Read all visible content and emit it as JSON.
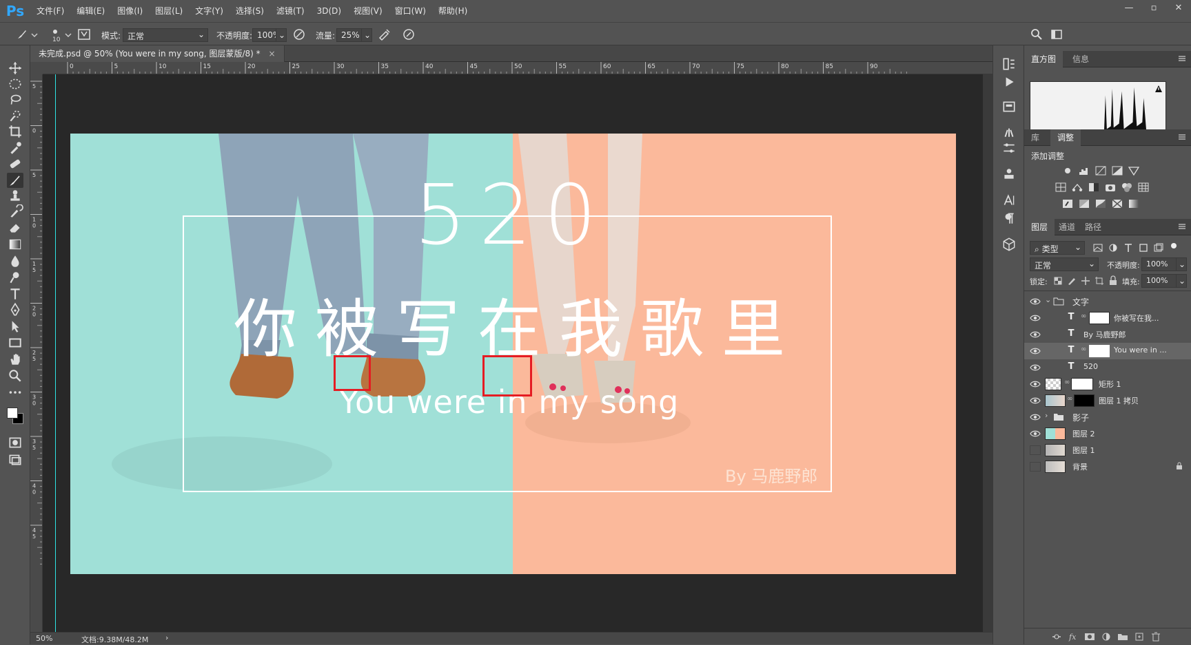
{
  "app": {
    "logo": "Ps"
  },
  "menu": [
    "文件(F)",
    "编辑(E)",
    "图像(I)",
    "图层(L)",
    "文字(Y)",
    "选择(S)",
    "滤镜(T)",
    "3D(D)",
    "视图(V)",
    "窗口(W)",
    "帮助(H)"
  ],
  "window_controls": [
    "minimize-icon",
    "restore-icon",
    "close-icon"
  ],
  "options": {
    "brush_size": "10",
    "mode_label": "模式:",
    "mode_value": "正常",
    "opacity_label": "不透明度:",
    "opacity_value": "100%",
    "flow_label": "流量:",
    "flow_value": "25%"
  },
  "document": {
    "tab_title": "未完成.psd @ 50% (You were in my song, 图层蒙版/8) *",
    "tab_close": "×",
    "zoom": "50%",
    "doc_size": "文档:9.38M/48.2M",
    "status_arrow": "›"
  },
  "ruler_h": [
    "0",
    "5",
    "10",
    "15",
    "20",
    "25",
    "30",
    "35",
    "40",
    "45",
    "50",
    "55",
    "60",
    "65",
    "70",
    "75",
    "80",
    "85",
    "90"
  ],
  "ruler_v": [
    "5",
    "0",
    "5",
    "1 0",
    "1 5",
    "2 0",
    "2 5",
    "3 0",
    "3 5",
    "4 0",
    "4 5"
  ],
  "artwork": {
    "number": "520",
    "headline": "你被写在我歌里",
    "tagline": "You were in my song",
    "byline": "By 马鹿野郎",
    "left_color": "#a0e0d7",
    "right_color": "#fbb99b",
    "selection_color": "#e51c23"
  },
  "panels": {
    "top_tabs": [
      "直方图",
      "信息"
    ],
    "adj_tabs": [
      "库",
      "调整"
    ],
    "add_adjustment": "添加调整",
    "layer_tabs": [
      "图层",
      "通道",
      "路径"
    ],
    "filter_kind": "类型",
    "blend_mode": "正常",
    "opacity_label": "不透明度:",
    "opacity_value": "100%",
    "lock_label": "锁定:",
    "fill_label": "填充:",
    "fill_value": "100%"
  },
  "layers": [
    {
      "name": "文字",
      "kind": "group-open",
      "visible": true
    },
    {
      "name": "你被写在我...",
      "kind": "text-mask",
      "visible": true
    },
    {
      "name": "By 马鹿野郎",
      "kind": "text",
      "visible": true
    },
    {
      "name": "You were in ...",
      "kind": "text-mask",
      "visible": true,
      "selected": true
    },
    {
      "name": "520",
      "kind": "text",
      "visible": true
    },
    {
      "name": "矩形 1",
      "kind": "shape",
      "visible": true
    },
    {
      "name": "图层 1 拷贝",
      "kind": "image-mask",
      "visible": true
    },
    {
      "name": "影子",
      "kind": "group-closed",
      "visible": true
    },
    {
      "name": "图层 2",
      "kind": "color",
      "visible": true
    },
    {
      "name": "图层 1",
      "kind": "image",
      "visible": false
    },
    {
      "name": "背景",
      "kind": "background",
      "visible": false,
      "locked": true
    }
  ]
}
